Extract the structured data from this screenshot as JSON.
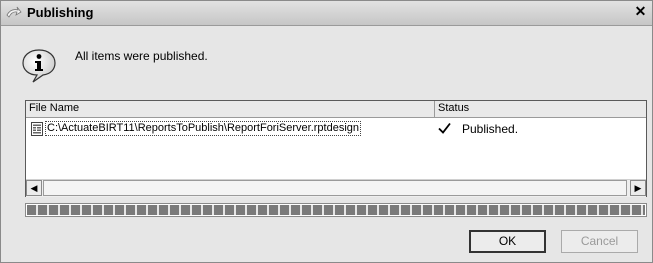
{
  "window": {
    "title": "Publishing",
    "close_glyph": "✕"
  },
  "message": "All items were published.",
  "icons": {
    "title": "publish-icon",
    "info": "info-icon",
    "file": "report-file-icon",
    "status": "checkmark-icon"
  },
  "list": {
    "columns": [
      "File Name",
      "Status"
    ],
    "rows": [
      {
        "file": "C:\\ActuateBIRT11\\ReportsToPublish\\ReportForiServer.rptdesign",
        "status": "Published."
      }
    ]
  },
  "scrollbar": {
    "left_glyph": "◀",
    "right_glyph": "▶"
  },
  "progress": {
    "percent": 100
  },
  "buttons": {
    "ok": "OK",
    "cancel": "Cancel"
  }
}
